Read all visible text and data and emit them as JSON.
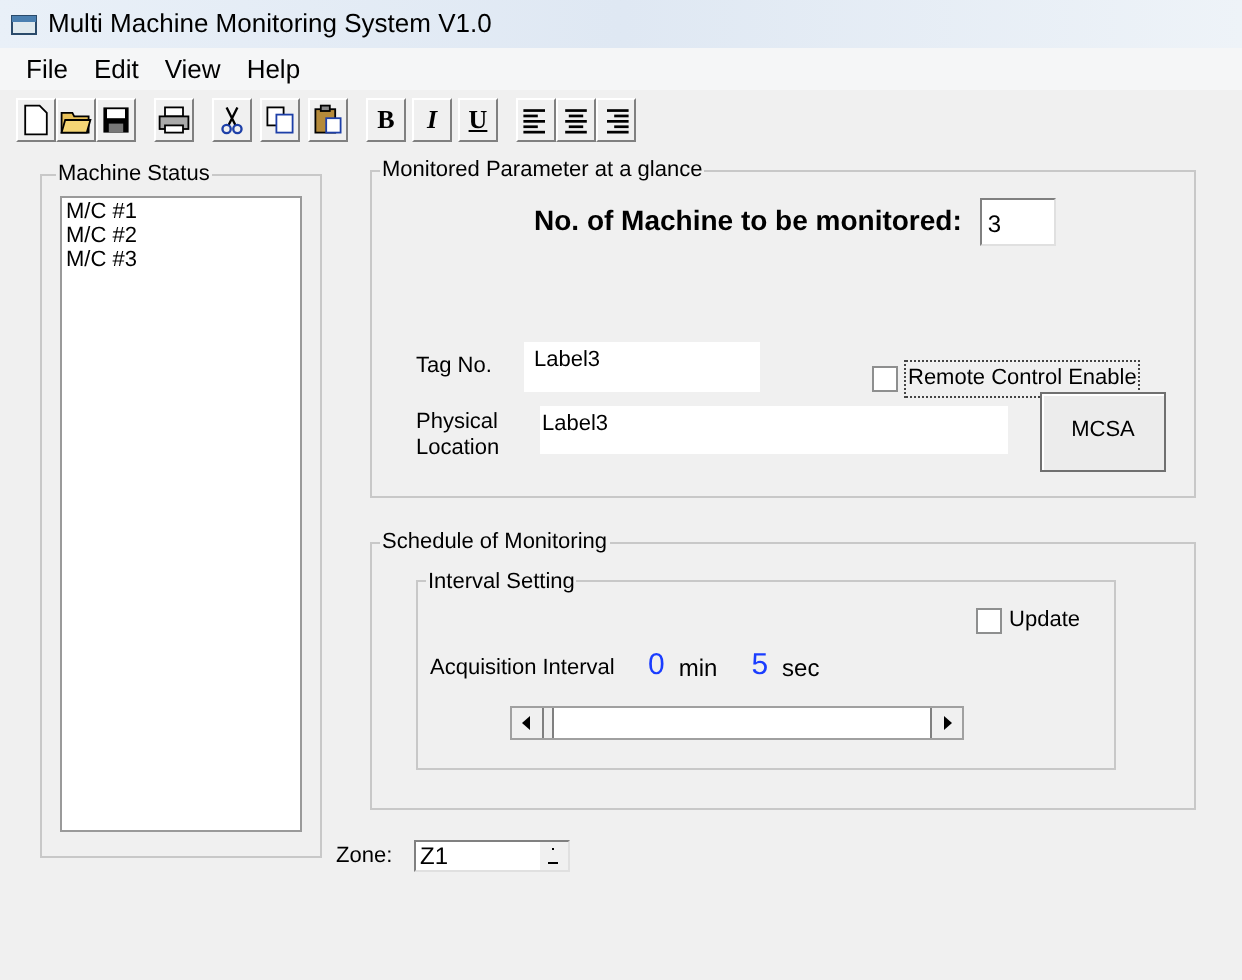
{
  "window": {
    "title": "Multi Machine Monitoring System V1.0"
  },
  "menu": [
    "File",
    "Edit",
    "View",
    "Help"
  ],
  "format_buttons": [
    "B",
    "I",
    "U"
  ],
  "machine_status": {
    "legend": "Machine Status",
    "items": [
      "M/C #1",
      "M/C #2",
      "M/C #3"
    ]
  },
  "monitored_parameter": {
    "legend": "Monitored Parameter at a glance",
    "count_label": "No. of Machine to be monitored:",
    "count_value": "3",
    "tag_label": "Tag No.",
    "tag_value": "Label3",
    "remote_control": {
      "label": "Remote Control Enable",
      "checked": false
    },
    "location_label": "Physical Location",
    "location_value": "Label3",
    "mcsa_button": "MCSA"
  },
  "schedule": {
    "legend": "Schedule of Monitoring",
    "interval_legend": "Interval Setting",
    "update": {
      "label": "Update",
      "checked": false
    },
    "interval_label": "Acquisition Interval",
    "minutes": "0",
    "min_unit": "min",
    "seconds": "5",
    "sec_unit": "sec"
  },
  "zone": {
    "label": "Zone:",
    "value": "Z1"
  }
}
